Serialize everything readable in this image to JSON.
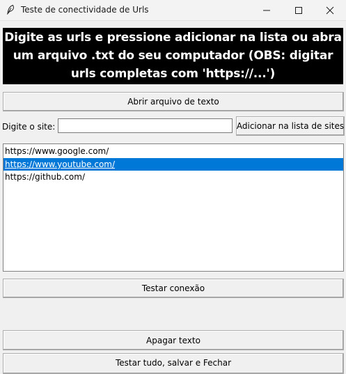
{
  "window": {
    "title": "Teste de conectividade de Urls",
    "icon": "feather-icon",
    "controls": [
      "minimize-icon",
      "maximize-icon",
      "close-icon"
    ]
  },
  "banner": {
    "text": "Digite as urls e pressione adicionar na lista ou abra um arquivo .txt do seu computador (OBS: digitar urls completas com 'https://...')",
    "background": "#000000",
    "color": "#ffffff"
  },
  "buttons": {
    "open_file": "Abrir arquivo de texto",
    "add_to_list": "Adicionar na lista de sites",
    "test_connection": "Testar conexão",
    "clear_text": "Apagar texto",
    "test_all_save_close": "Testar tudo, salvar e Fechar"
  },
  "site_entry": {
    "label": "Digite o site:",
    "value": ""
  },
  "url_list": {
    "items": [
      {
        "text": "https://www.google.com/",
        "selected": false
      },
      {
        "text": "https://www.youtube.com/",
        "selected": true
      },
      {
        "text": "https://github.com/",
        "selected": false
      }
    ],
    "selection_color": "#0078d7"
  }
}
